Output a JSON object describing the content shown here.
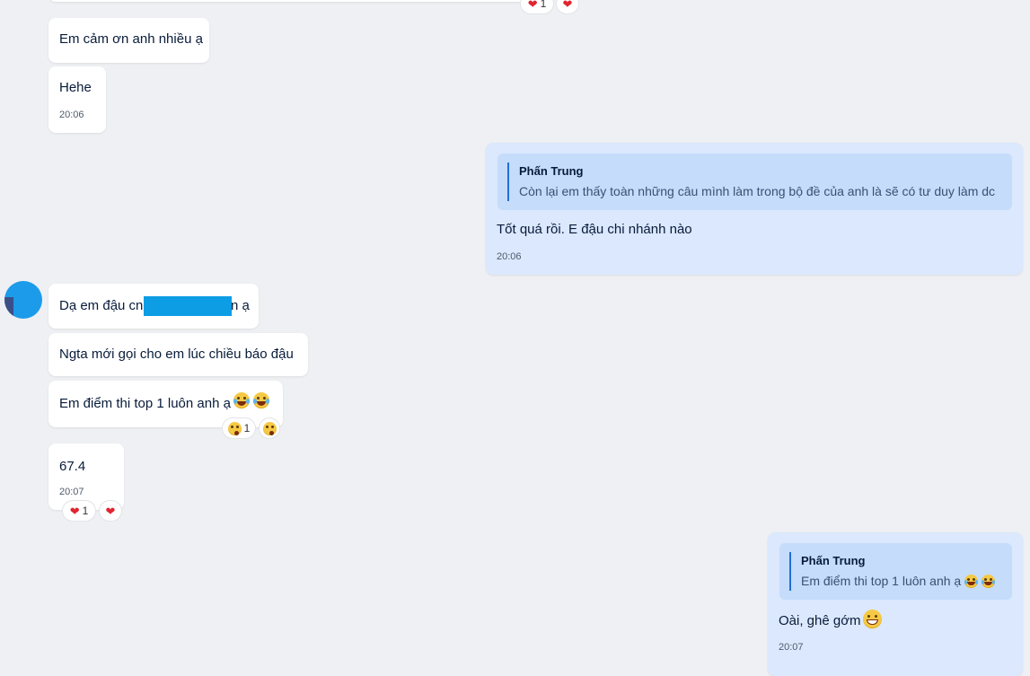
{
  "chat": {
    "top_reactions": {
      "count": "1"
    },
    "m1": {
      "text": "Em cảm ơn anh nhiều ạ"
    },
    "m2": {
      "text": "Hehe",
      "time": "20:06"
    },
    "m3": {
      "quote_name": "Phấn Trung",
      "quote_text": "Còn lại em thấy toàn những câu mình làm trong bộ đề của anh là sẽ có tư duy làm dc",
      "text": "Tốt quá rồi. E đậu chi nhánh nào",
      "time": "20:06"
    },
    "m4": {
      "text_before": "Dạ em đậu cn",
      "text_after": "n ạ"
    },
    "m5": {
      "text": "Ngta mới gọi cho em lúc chiều báo đậu"
    },
    "m6": {
      "text": "Em điểm thi top 1 luôn anh ạ",
      "reaction_count": "1"
    },
    "m7": {
      "text": "67.4",
      "time": "20:07",
      "reaction_count": "1"
    },
    "m8": {
      "quote_name": "Phấn Trung",
      "quote_text": "Em điểm thi top 1 luôn anh ạ",
      "text": "Oài, ghê gớm",
      "time": "20:07"
    }
  },
  "icons": {
    "heart": "heart-icon",
    "laugh": "laughing-tears-emoji",
    "wow": "surprised-emoji",
    "grin": "grinning-emoji"
  },
  "colors": {
    "background": "#eef0f3",
    "incoming_bubble": "#ffffff",
    "outgoing_bubble": "#dbe8fd",
    "quote_bg": "#c5dcfb",
    "quote_bar": "#1f6fd6",
    "redaction": "#0c9de4"
  }
}
